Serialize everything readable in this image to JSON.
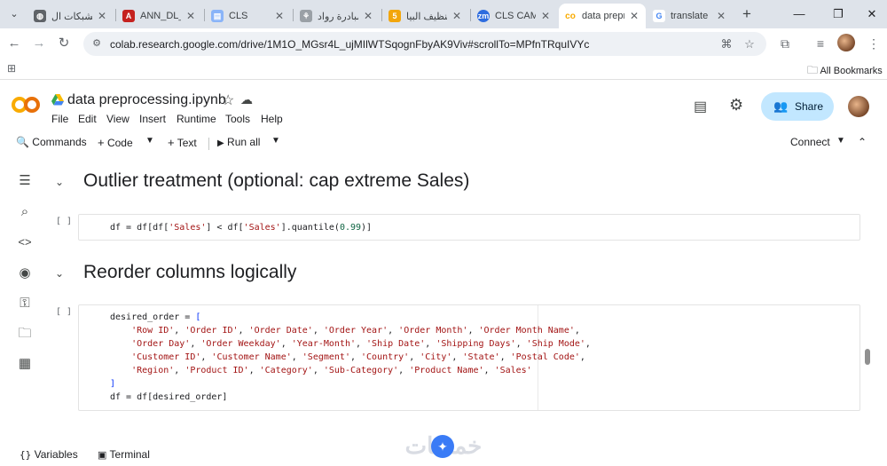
{
  "browser": {
    "tabs": [
      {
        "title": "الشبكات ال",
        "fav_color": "#5f6368",
        "fav_glyph": "◍"
      },
      {
        "title": "ANN_DL_A",
        "fav_color": "#c5221f",
        "fav_glyph": "A"
      },
      {
        "title": "CLS",
        "fav_color": "#8ab4f8",
        "fav_glyph": "▤"
      },
      {
        "title": "مبادرة رواد",
        "fav_color": "#9aa0a6",
        "fav_glyph": "⚘"
      },
      {
        "title": "تنظيف البيا",
        "fav_color": "#f2a60c",
        "fav_glyph": "5"
      },
      {
        "title": "CLS CAM_",
        "fav_color": "#2d6cdf",
        "fav_glyph": "zm"
      },
      {
        "title": "data prepro",
        "fav_color": "#f9ab00",
        "fav_glyph": "co"
      },
      {
        "title": "translate",
        "fav_color": "#4285f4",
        "fav_glyph": "G"
      }
    ],
    "url": "colab.research.google.com/drive/1M1O_MGsr4L_ujMIlWTSqognFbyAK9Viv#scrollTo=MPfnTRquIVYc",
    "bookmarks_label": "All Bookmarks"
  },
  "colab": {
    "notebook_title": "data preprocessing.ipynb",
    "menu": [
      "File",
      "Edit",
      "View",
      "Insert",
      "Runtime",
      "Tools",
      "Help"
    ],
    "share_label": "Share",
    "toolbar": {
      "commands": "Commands",
      "code": "Code",
      "text": "Text",
      "run_all": "Run all",
      "connect": "Connect"
    },
    "sections": [
      {
        "title": "Outlier treatment (optional: cap extreme Sales)",
        "cell_prompt": "[ ]",
        "code": [
          "df = df[df['Sales'] < df['Sales'].quantile(0.99)]"
        ]
      },
      {
        "title": "Reorder columns logically",
        "cell_prompt": "[ ]",
        "code": [
          "desired_order = [",
          "    'Row ID', 'Order ID', 'Order Date', 'Order Year', 'Order Month', 'Order Month Name',",
          "    'Order Day', 'Order Weekday', 'Year-Month', 'Ship Date', 'Shipping Days', 'Ship Mode',",
          "    'Customer ID', 'Customer Name', 'Segment', 'Country', 'City', 'State', 'Postal Code',",
          "    'Region', 'Product ID', 'Category', 'Sub-Category', 'Product Name', 'Sales'",
          "]",
          "df = df[desired_order]"
        ]
      }
    ],
    "bottom": {
      "variables": "Variables",
      "terminal": "Terminal"
    }
  },
  "watermark_text": "خمسات"
}
